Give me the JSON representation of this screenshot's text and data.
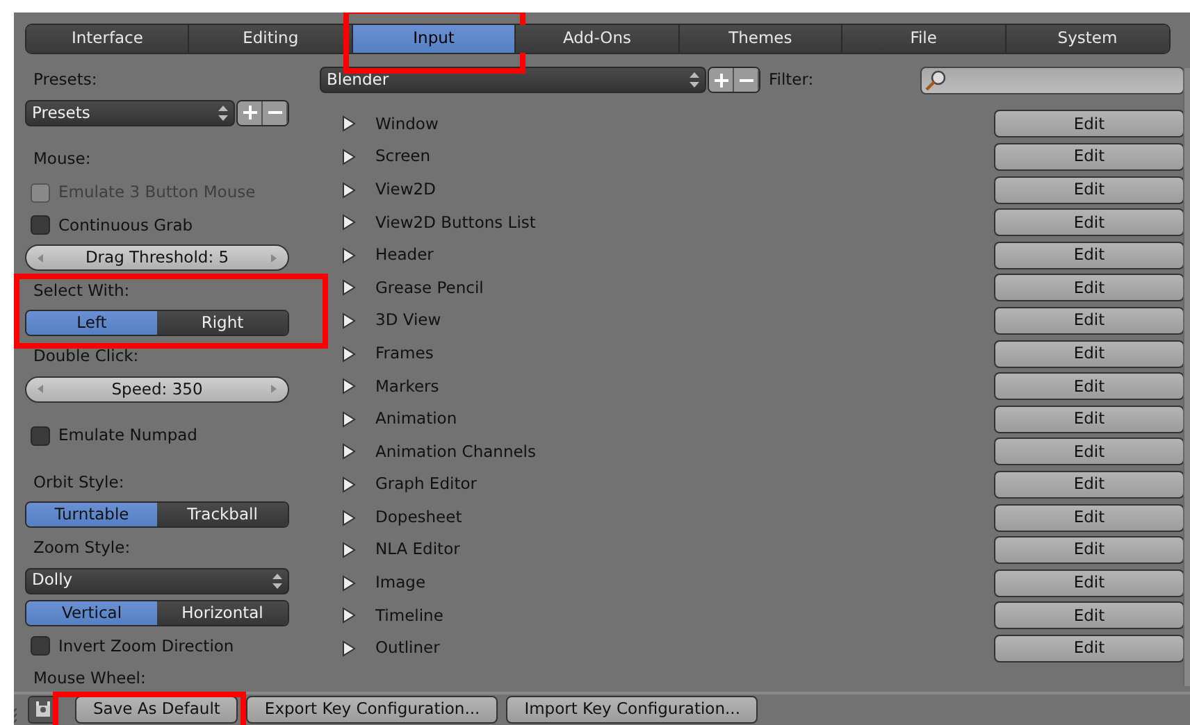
{
  "tabs": [
    {
      "label": "Interface",
      "selected": false,
      "highlighted": false
    },
    {
      "label": "Editing",
      "selected": false,
      "highlighted": false
    },
    {
      "label": "Input",
      "selected": true,
      "highlighted": true
    },
    {
      "label": "Add-Ons",
      "selected": false,
      "highlighted": false
    },
    {
      "label": "Themes",
      "selected": false,
      "highlighted": false
    },
    {
      "label": "File",
      "selected": false,
      "highlighted": false
    },
    {
      "label": "System",
      "selected": false,
      "highlighted": false
    }
  ],
  "left_panel": {
    "sections": [
      {
        "items": [
          {
            "kind": "label",
            "text": "Presets:"
          },
          {
            "kind": "dropdown",
            "value": "Presets",
            "add_remove": true
          }
        ]
      },
      {
        "items": [
          {
            "kind": "label",
            "text": "Mouse:"
          },
          {
            "kind": "checkbox",
            "text": "Emulate 3 Button Mouse",
            "checked": false,
            "disabled": true
          },
          {
            "kind": "checkbox",
            "text": "Continuous Grab",
            "checked": false,
            "disabled": false
          },
          {
            "kind": "slider",
            "text": "Drag Threshold: 5"
          },
          {
            "kind": "group",
            "highlighted": true,
            "items": [
              {
                "kind": "label",
                "text": "Select With:"
              },
              {
                "kind": "toggle",
                "options": [
                  {
                    "label": "Left",
                    "selected": true
                  },
                  {
                    "label": "Right",
                    "selected": false
                  }
                ]
              }
            ]
          },
          {
            "kind": "label",
            "text": "Double Click:"
          },
          {
            "kind": "slider",
            "text": "Speed: 350"
          }
        ]
      },
      {
        "items": [
          {
            "kind": "checkbox",
            "text": "Emulate Numpad",
            "checked": false,
            "disabled": false
          }
        ]
      },
      {
        "items": [
          {
            "kind": "label",
            "text": "Orbit Style:"
          },
          {
            "kind": "toggle",
            "options": [
              {
                "label": "Turntable",
                "selected": true
              },
              {
                "label": "Trackball",
                "selected": false
              }
            ]
          },
          {
            "kind": "label",
            "text": "Zoom Style:"
          },
          {
            "kind": "dropdown",
            "value": "Dolly",
            "add_remove": false
          },
          {
            "kind": "toggle",
            "options": [
              {
                "label": "Vertical",
                "selected": true
              },
              {
                "label": "Horizontal",
                "selected": false
              }
            ]
          },
          {
            "kind": "checkbox",
            "text": "Invert Zoom Direction",
            "checked": false,
            "disabled": false
          },
          {
            "kind": "label",
            "text": "Mouse Wheel:"
          }
        ]
      }
    ]
  },
  "keymap": {
    "preset": "Blender",
    "filter_label": "Filter:",
    "rows": [
      {
        "name": "Window",
        "expanded": false,
        "button": "Edit"
      },
      {
        "name": "Screen",
        "expanded": false,
        "button": "Edit"
      },
      {
        "name": "View2D",
        "expanded": false,
        "button": "Edit"
      },
      {
        "name": "View2D Buttons List",
        "expanded": false,
        "button": "Edit"
      },
      {
        "name": "Header",
        "expanded": false,
        "button": "Edit"
      },
      {
        "name": "Grease Pencil",
        "expanded": false,
        "button": "Edit"
      },
      {
        "name": "3D View",
        "expanded": false,
        "button": "Edit"
      },
      {
        "name": "Frames",
        "expanded": false,
        "button": "Edit"
      },
      {
        "name": "Markers",
        "expanded": false,
        "button": "Edit"
      },
      {
        "name": "Animation",
        "expanded": false,
        "button": "Edit"
      },
      {
        "name": "Animation Channels",
        "expanded": false,
        "button": "Edit"
      },
      {
        "name": "Graph Editor",
        "expanded": false,
        "button": "Edit"
      },
      {
        "name": "Dopesheet",
        "expanded": false,
        "button": "Edit"
      },
      {
        "name": "NLA Editor",
        "expanded": false,
        "button": "Edit"
      },
      {
        "name": "Image",
        "expanded": false,
        "button": "Edit"
      },
      {
        "name": "Timeline",
        "expanded": false,
        "button": "Edit"
      },
      {
        "name": "Outliner",
        "expanded": false,
        "button": "Edit"
      }
    ]
  },
  "bottom_bar": {
    "buttons": [
      {
        "label": "Save As Default",
        "highlighted": true
      },
      {
        "label": "Export Key Configuration...",
        "highlighted": false
      },
      {
        "label": "Import Key Configuration...",
        "highlighted": false
      }
    ]
  }
}
